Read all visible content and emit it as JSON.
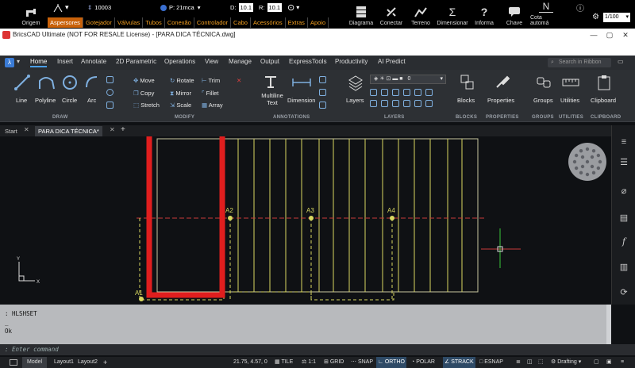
{
  "hydro_bar": {
    "origem": "Origem",
    "spinner_value": "10003",
    "pressure": "P: 21mca",
    "d_label": "D:",
    "d_value": "10.1",
    "r_label": "R:",
    "r_value": "10.1",
    "buttons": [
      "Diagrama",
      "Conectar",
      "Terreno",
      "Dimensionar",
      "Informa",
      "Chave",
      "Cota automá"
    ],
    "scale": "1/100",
    "layer_tabs": [
      "Aspersores",
      "Gotejador",
      "Válvulas",
      "Tubos",
      "Conexão",
      "Controlador",
      "Cabo",
      "Acessórios",
      "Extras",
      "Apoio"
    ]
  },
  "title": "BricsCAD Ultimate (NOT FOR RESALE License) - [PARA DICA TÉCNICA.dwg]",
  "ribbon_tabs": [
    "Home",
    "Insert",
    "Annotate",
    "2D Parametric",
    "Operations",
    "View",
    "Manage",
    "Output",
    "ExpressTools",
    "Productivity",
    "AI Predict"
  ],
  "search_placeholder": "Search in Ribbon",
  "ribbon": {
    "draw": [
      "Line",
      "Polyline",
      "Circle",
      "Arc"
    ],
    "modify": [
      "Move",
      "Rotate",
      "Trim",
      "Copy",
      "Mirror",
      "Fillet",
      "Stretch",
      "Scale",
      "Array"
    ],
    "annotations": [
      "Multiline Text",
      "Dimension"
    ],
    "layers_label": "Layers",
    "layer_value": "0",
    "blocks": "Blocks",
    "properties": "Properties",
    "groups": "Groups",
    "utilities": "Utilities",
    "clipboard": "Clipboard",
    "groups_titles": [
      "DRAW",
      "MODIFY",
      "ANNOTATIONS",
      "LAYERS",
      "BLOCKS",
      "PROPERTIES",
      "GROUPS",
      "UTILITIES",
      "CLIPBOARD"
    ]
  },
  "doc_tabs": [
    "Start",
    "PARA DICA TÉCNICA*"
  ],
  "drawing": {
    "labels": [
      "A1",
      "A2",
      "A3",
      "A4"
    ],
    "ucs_x": "X",
    "ucs_y": "Y"
  },
  "command": {
    "history": [
      ": HLSHSET",
      "_",
      "Ok"
    ],
    "placeholder": ": Enter command"
  },
  "status": {
    "tabs": [
      "Model",
      "Layout1",
      "Layout2"
    ],
    "coords": "21.75, 4.57, 0",
    "items": [
      "TILE",
      "1:1",
      "GRID",
      "SNAP",
      "ORTHO",
      "POLAR",
      "STRACK",
      "ESNAP"
    ],
    "workspace": "Drafting"
  },
  "colors": {
    "highlight_box": "#e01e1e",
    "drawing_lines": "#d8d860",
    "dashed_red": "#c83a3a"
  }
}
